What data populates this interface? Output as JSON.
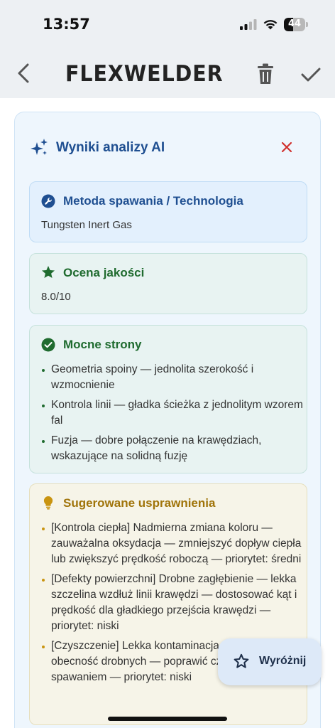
{
  "status_bar": {
    "time": "13:57",
    "battery_level": "44",
    "battery_fraction": 0.44
  },
  "nav": {
    "logo": "FLEXWELDER",
    "icons": [
      "chevron-left-icon",
      "trash-icon",
      "check-icon"
    ]
  },
  "panel": {
    "title": "Wyniki analizy AI",
    "icon": "sparkle-icon",
    "accent_color": "#1f4f91",
    "close_color": "#d0312d"
  },
  "method_card": {
    "title": "Metoda spawania / Technologia",
    "value": "Tungsten Inert Gas",
    "icon": "wrench-icon",
    "color": "#1f4f91"
  },
  "quality_card": {
    "title": "Ocena jakości",
    "value": "8.0/10",
    "icon": "star-icon",
    "color": "#1f6b2f"
  },
  "strengths_card": {
    "title": "Mocne strony",
    "icon": "check-circle-icon",
    "color": "#1f6b2f",
    "items": [
      "Geometria spoiny — jednolita szerokość i wzmocnienie",
      "Kontrola linii — gładka ścieżka z jednolitym wzorem fal",
      "Fuzja — dobre połączenie na krawędziach, wskazujące na solidną fuzję"
    ]
  },
  "improvements_card": {
    "title": "Sugerowane usprawnienia",
    "icon": "lightbulb-icon",
    "color": "#a0740a",
    "items": [
      "[Kontrola ciepła] Nadmierna zmiana koloru — zauważalna oksydacja — zmniejszyć dopływ ciepła lub zwiększyć prędkość roboczą — priorytet: średni",
      "[Defekty powierzchni] Drobne zagłębienie — lekka szczelina wzdłuż linii krawędzi — dostosować kąt i prędkość dla gładkiego przejścia krawędzi — priorytet: niski",
      "[Czyszczenie] Lekka kontaminacja powierzchni — obecność drobnych — poprawić czyszczenie przed spawaniem — priorytet: niski"
    ]
  },
  "fab": {
    "label": "Wyróżnij",
    "icon": "star-outline-icon"
  }
}
